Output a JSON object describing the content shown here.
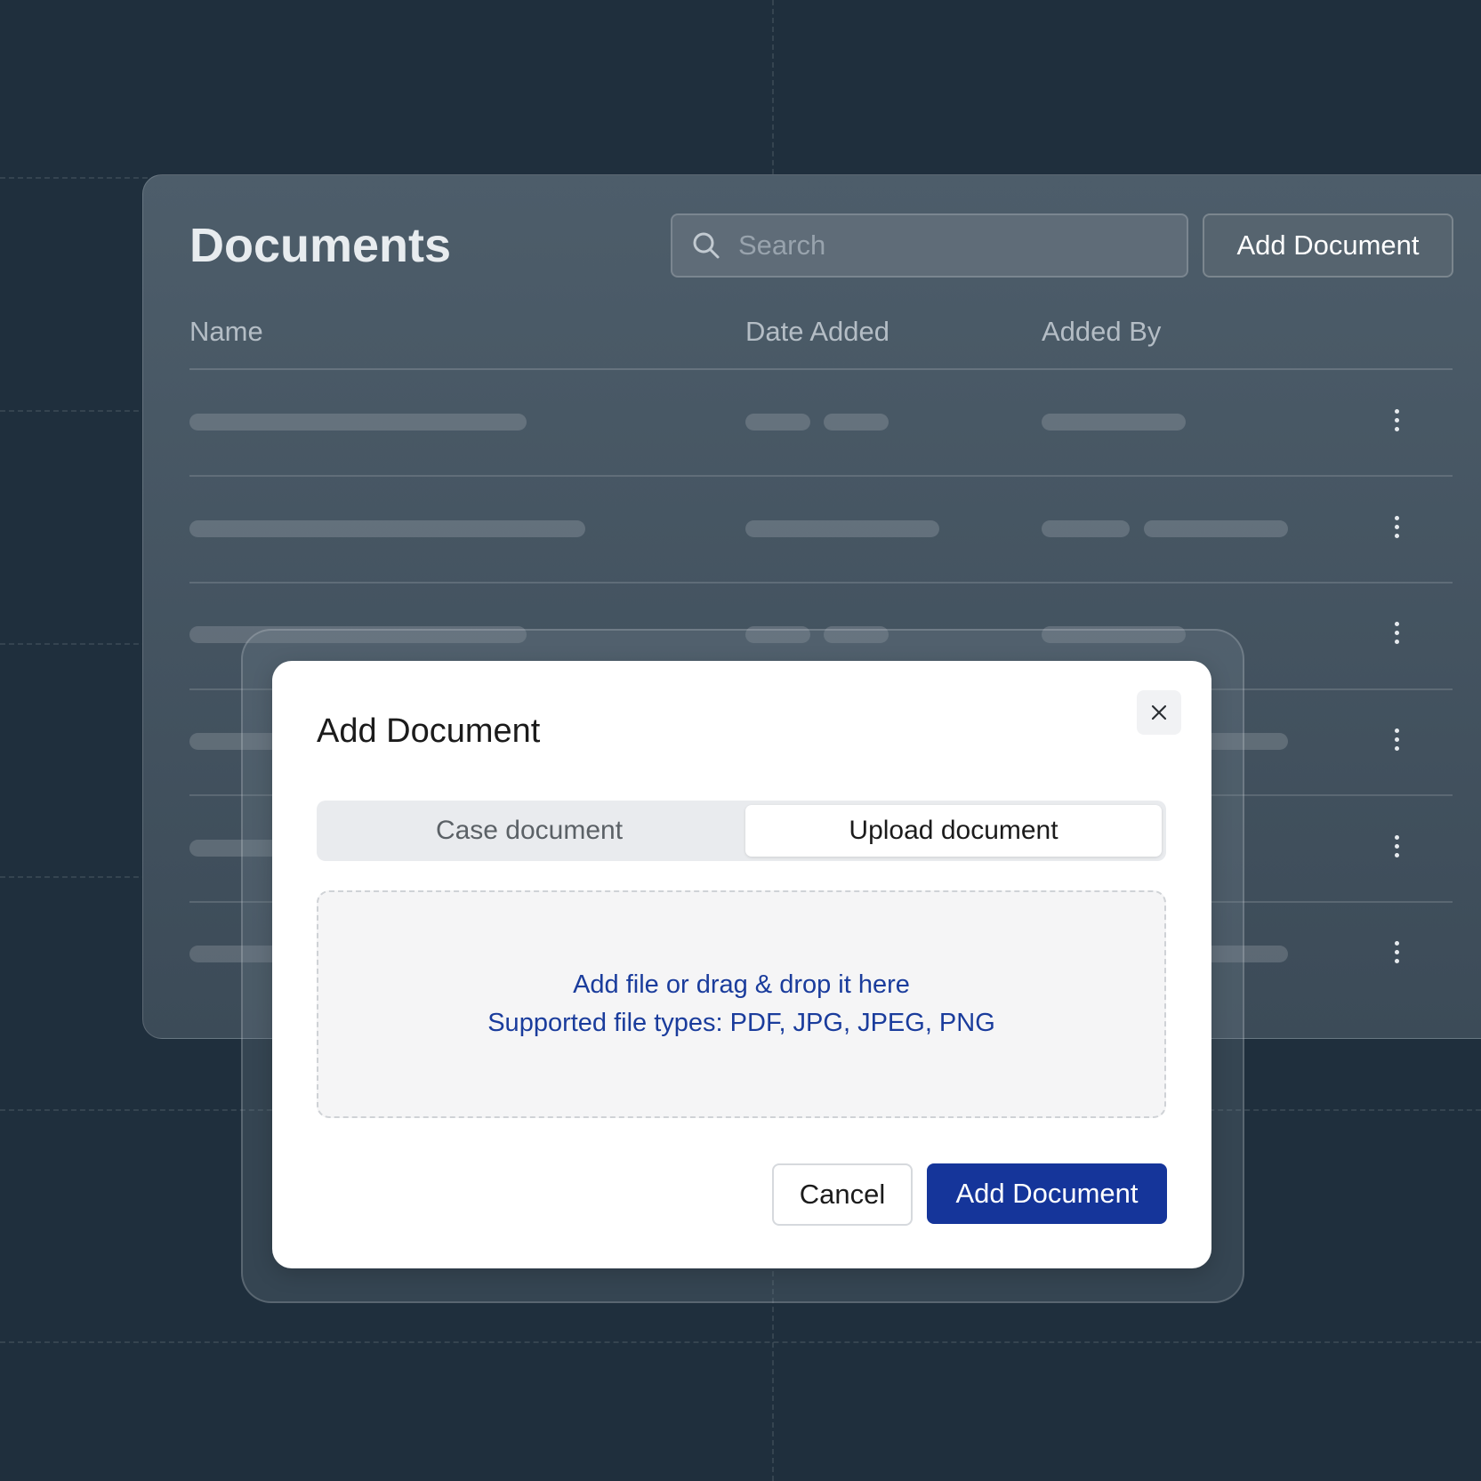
{
  "background_page": {
    "title": "Documents",
    "search": {
      "placeholder": "Search"
    },
    "add_button_label": "Add Document",
    "table": {
      "columns": [
        "Name",
        "Date Added",
        "Added By"
      ],
      "row_count": 6
    }
  },
  "modal": {
    "title": "Add Document",
    "close_icon": "close-icon",
    "tabs": [
      {
        "label": "Case document",
        "selected": false
      },
      {
        "label": "Upload document",
        "selected": true
      }
    ],
    "dropzone": {
      "line1": "Add file or drag & drop it here",
      "line2": "Supported file types: PDF, JPG, JPEG, PNG"
    },
    "cancel_label": "Cancel",
    "submit_label": "Add Document"
  },
  "colors": {
    "page_background": "#1f2f3d",
    "primary_button": "#15359a",
    "link_text": "#1a3c9c"
  }
}
